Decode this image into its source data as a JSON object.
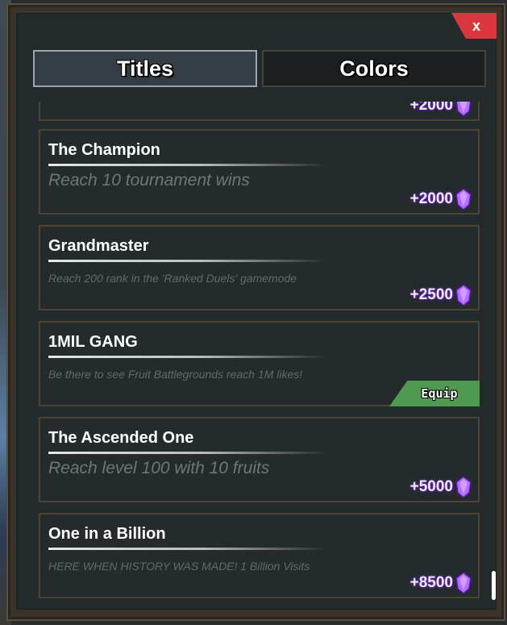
{
  "close_label": "x",
  "tabs": [
    {
      "label": "Titles",
      "active": true
    },
    {
      "label": "Colors",
      "active": false
    }
  ],
  "titles": [
    {
      "name": "",
      "description": "",
      "reward": "+2000",
      "partial": true
    },
    {
      "name": "The Champion",
      "description": "Reach 10 tournament wins",
      "reward": "+2000"
    },
    {
      "name": "Grandmaster",
      "description": "Reach 200 rank in the 'Ranked Duels' gamemode",
      "reward": "+2500"
    },
    {
      "name": "1MIL GANG",
      "description": "Be there to see Fruit Battlegrounds reach 1M likes!",
      "action": "Equip"
    },
    {
      "name": "The Ascended One",
      "description": "Reach level 100 with 10 fruits",
      "reward": "+5000"
    },
    {
      "name": "One in a Billion",
      "description": "HERE WHEN HISTORY WAS MADE! 1 Billion Visits",
      "reward": "+8500"
    }
  ],
  "icons": {
    "reward": "purple-gem-icon",
    "close": "close-icon"
  },
  "colors": {
    "panel": "#232a2c",
    "frame": "#3a332a",
    "close": "#d9363e",
    "equip": "#4f9a50",
    "reward_glow": "#7b2fd6"
  }
}
